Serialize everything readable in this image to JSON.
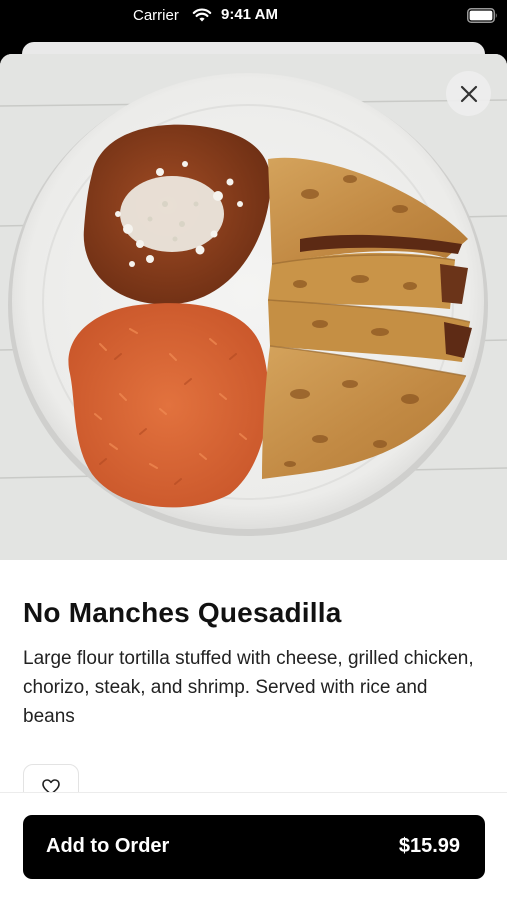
{
  "status_bar": {
    "carrier": "Carrier",
    "time": "9:41 AM"
  },
  "hero": {
    "image": "quesadilla-plate-photo"
  },
  "item": {
    "title": "No Manches Quesadilla",
    "description": "Large flour tortilla stuffed with cheese, grilled chicken, chorizo, steak, and shrimp. Served with rice and beans"
  },
  "actions": {
    "favorite_icon": "heart-icon",
    "close_icon": "close-icon",
    "add_to_order_label": "Add to Order",
    "price": "$15.99"
  },
  "colors": {
    "primary_button": "#000000",
    "background": "#ffffff"
  }
}
